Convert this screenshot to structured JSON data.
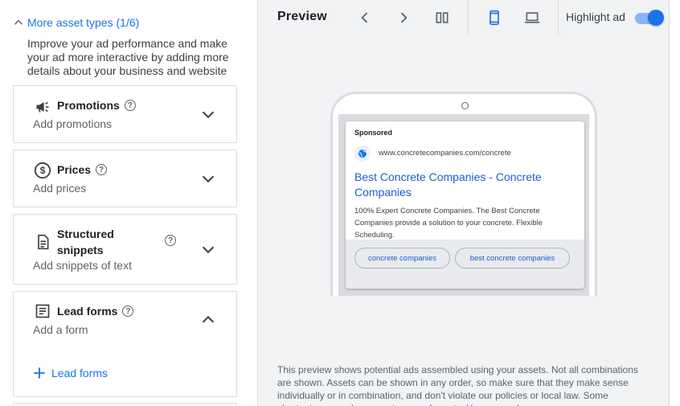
{
  "left": {
    "section_title": "More asset types (1/6)",
    "section_desc": "Improve your ad performance and make your ad more interactive by adding more details about your business and website",
    "cards": [
      {
        "title": "Promotions",
        "subtitle": "Add promotions",
        "icon": "megaphone-icon"
      },
      {
        "title": "Prices",
        "subtitle": "Add prices",
        "icon": "dollar-circle-icon"
      },
      {
        "title_line1": "Structured",
        "title_line2": "snippets",
        "subtitle": "Add snippets of text",
        "icon": "snippet-doc-icon"
      },
      {
        "title": "Lead forms",
        "subtitle": "Add a form",
        "icon": "form-icon",
        "add_label": "Lead forms"
      }
    ],
    "help_glyph": "?"
  },
  "preview": {
    "title": "Preview",
    "highlight_label": "Highlight ad",
    "highlight_on": true,
    "ad": {
      "sponsored": "Sponsored",
      "url": "www.concretecompanies.com/concrete",
      "headline": "Best Concrete Companies - Concrete Companies",
      "description": "100% Expert Concrete Companies. The Best Concrete Companies provide a solution to your concrete. Flexible Scheduling.",
      "sitelinks": [
        "concrete companies",
        "best concrete companies"
      ]
    },
    "disclaimer": "This preview shows potential ads assembled using your assets. Not all combinations are shown. Assets can be shown in any order, so make sure that they make sense individually or in combination, and don't violate our policies or local law. Some shortening may also occur in some formats. You can make sure"
  },
  "colors": {
    "accent": "#1a73e8",
    "panel_bg": "#f1f3f4",
    "border": "#dadce0"
  }
}
